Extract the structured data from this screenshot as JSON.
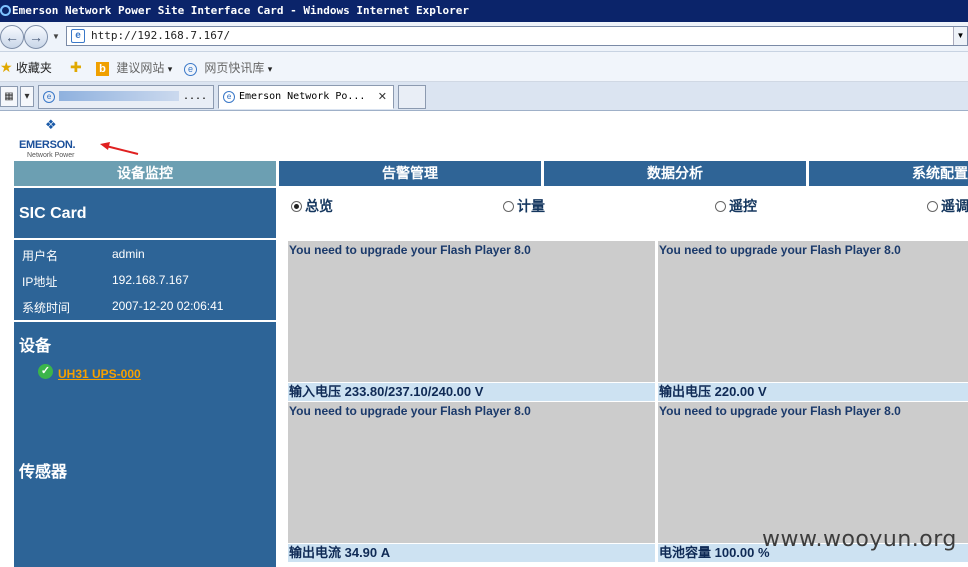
{
  "window": {
    "title": "Emerson Network Power Site Interface Card - Windows Internet Explorer"
  },
  "browser": {
    "url": "http://192.168.7.167/",
    "favorites": {
      "label": "收藏夹",
      "suggested_sites": "建议网站",
      "web_slices": "网页快讯库"
    },
    "tabs": [
      {
        "label": "....",
        "blurred": true
      },
      {
        "label": "Emerson Network Po..."
      }
    ],
    "close_glyph": "✕"
  },
  "brand": {
    "name": "EMERSON.",
    "sub": "Network Power"
  },
  "menu": [
    {
      "label": "设备监控"
    },
    {
      "label": "告警管理"
    },
    {
      "label": "数据分析"
    },
    {
      "label": "系统配置"
    }
  ],
  "sidebar": {
    "card_title": "SIC Card",
    "info": [
      {
        "label": "用户名",
        "value": "admin"
      },
      {
        "label": "IP地址",
        "value": "192.168.7.167"
      },
      {
        "label": "系统时间",
        "value": "2007-12-20 02:06:41"
      }
    ],
    "devices_heading": "设备",
    "device_link": "UH31 UPS-000",
    "sensors_heading": "传感器"
  },
  "view_options": [
    {
      "label": "总览",
      "checked": true
    },
    {
      "label": "计量",
      "checked": false
    },
    {
      "label": "遥控",
      "checked": false
    },
    {
      "label": "遥调",
      "checked": false
    }
  ],
  "panels": [
    {
      "message": "You need to upgrade your Flash Player 8.0",
      "caption": "输入电压 233.80/237.10/240.00 V"
    },
    {
      "message": "You need to upgrade your Flash Player 8.0",
      "caption": "输出电压 220.00 V"
    },
    {
      "message": "You need to upgrade your Flash Player 8.0",
      "caption": "输出电流 34.90 A"
    },
    {
      "message": "You need to upgrade your Flash Player 8.0",
      "caption": "电池容量 100.00 %"
    }
  ],
  "watermark": "www.wooyun.org",
  "colors": {
    "menu_bg": "#2f6496",
    "menu_active": "#6c9fb2",
    "sidebar_bg": "#2d6497",
    "link": "#f6a000"
  }
}
